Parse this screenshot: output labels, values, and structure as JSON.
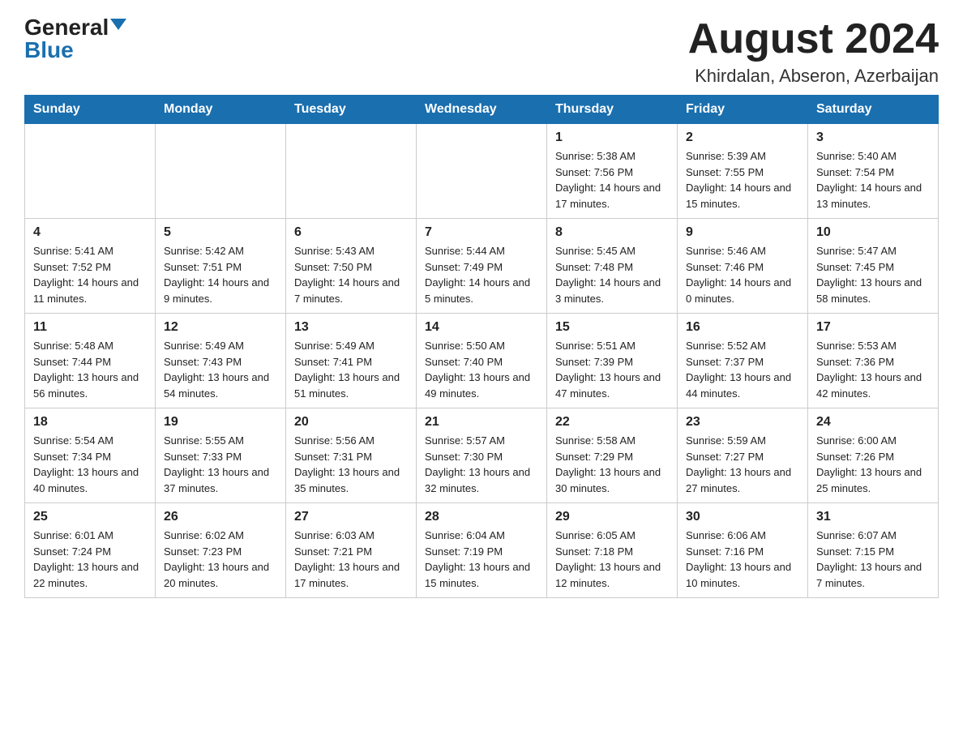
{
  "header": {
    "logo_general": "General",
    "logo_blue": "Blue",
    "month_year": "August 2024",
    "location": "Khirdalan, Abseron, Azerbaijan"
  },
  "days_of_week": [
    "Sunday",
    "Monday",
    "Tuesday",
    "Wednesday",
    "Thursday",
    "Friday",
    "Saturday"
  ],
  "weeks": [
    [
      {
        "day": "",
        "info": ""
      },
      {
        "day": "",
        "info": ""
      },
      {
        "day": "",
        "info": ""
      },
      {
        "day": "",
        "info": ""
      },
      {
        "day": "1",
        "info": "Sunrise: 5:38 AM\nSunset: 7:56 PM\nDaylight: 14 hours and 17 minutes."
      },
      {
        "day": "2",
        "info": "Sunrise: 5:39 AM\nSunset: 7:55 PM\nDaylight: 14 hours and 15 minutes."
      },
      {
        "day": "3",
        "info": "Sunrise: 5:40 AM\nSunset: 7:54 PM\nDaylight: 14 hours and 13 minutes."
      }
    ],
    [
      {
        "day": "4",
        "info": "Sunrise: 5:41 AM\nSunset: 7:52 PM\nDaylight: 14 hours and 11 minutes."
      },
      {
        "day": "5",
        "info": "Sunrise: 5:42 AM\nSunset: 7:51 PM\nDaylight: 14 hours and 9 minutes."
      },
      {
        "day": "6",
        "info": "Sunrise: 5:43 AM\nSunset: 7:50 PM\nDaylight: 14 hours and 7 minutes."
      },
      {
        "day": "7",
        "info": "Sunrise: 5:44 AM\nSunset: 7:49 PM\nDaylight: 14 hours and 5 minutes."
      },
      {
        "day": "8",
        "info": "Sunrise: 5:45 AM\nSunset: 7:48 PM\nDaylight: 14 hours and 3 minutes."
      },
      {
        "day": "9",
        "info": "Sunrise: 5:46 AM\nSunset: 7:46 PM\nDaylight: 14 hours and 0 minutes."
      },
      {
        "day": "10",
        "info": "Sunrise: 5:47 AM\nSunset: 7:45 PM\nDaylight: 13 hours and 58 minutes."
      }
    ],
    [
      {
        "day": "11",
        "info": "Sunrise: 5:48 AM\nSunset: 7:44 PM\nDaylight: 13 hours and 56 minutes."
      },
      {
        "day": "12",
        "info": "Sunrise: 5:49 AM\nSunset: 7:43 PM\nDaylight: 13 hours and 54 minutes."
      },
      {
        "day": "13",
        "info": "Sunrise: 5:49 AM\nSunset: 7:41 PM\nDaylight: 13 hours and 51 minutes."
      },
      {
        "day": "14",
        "info": "Sunrise: 5:50 AM\nSunset: 7:40 PM\nDaylight: 13 hours and 49 minutes."
      },
      {
        "day": "15",
        "info": "Sunrise: 5:51 AM\nSunset: 7:39 PM\nDaylight: 13 hours and 47 minutes."
      },
      {
        "day": "16",
        "info": "Sunrise: 5:52 AM\nSunset: 7:37 PM\nDaylight: 13 hours and 44 minutes."
      },
      {
        "day": "17",
        "info": "Sunrise: 5:53 AM\nSunset: 7:36 PM\nDaylight: 13 hours and 42 minutes."
      }
    ],
    [
      {
        "day": "18",
        "info": "Sunrise: 5:54 AM\nSunset: 7:34 PM\nDaylight: 13 hours and 40 minutes."
      },
      {
        "day": "19",
        "info": "Sunrise: 5:55 AM\nSunset: 7:33 PM\nDaylight: 13 hours and 37 minutes."
      },
      {
        "day": "20",
        "info": "Sunrise: 5:56 AM\nSunset: 7:31 PM\nDaylight: 13 hours and 35 minutes."
      },
      {
        "day": "21",
        "info": "Sunrise: 5:57 AM\nSunset: 7:30 PM\nDaylight: 13 hours and 32 minutes."
      },
      {
        "day": "22",
        "info": "Sunrise: 5:58 AM\nSunset: 7:29 PM\nDaylight: 13 hours and 30 minutes."
      },
      {
        "day": "23",
        "info": "Sunrise: 5:59 AM\nSunset: 7:27 PM\nDaylight: 13 hours and 27 minutes."
      },
      {
        "day": "24",
        "info": "Sunrise: 6:00 AM\nSunset: 7:26 PM\nDaylight: 13 hours and 25 minutes."
      }
    ],
    [
      {
        "day": "25",
        "info": "Sunrise: 6:01 AM\nSunset: 7:24 PM\nDaylight: 13 hours and 22 minutes."
      },
      {
        "day": "26",
        "info": "Sunrise: 6:02 AM\nSunset: 7:23 PM\nDaylight: 13 hours and 20 minutes."
      },
      {
        "day": "27",
        "info": "Sunrise: 6:03 AM\nSunset: 7:21 PM\nDaylight: 13 hours and 17 minutes."
      },
      {
        "day": "28",
        "info": "Sunrise: 6:04 AM\nSunset: 7:19 PM\nDaylight: 13 hours and 15 minutes."
      },
      {
        "day": "29",
        "info": "Sunrise: 6:05 AM\nSunset: 7:18 PM\nDaylight: 13 hours and 12 minutes."
      },
      {
        "day": "30",
        "info": "Sunrise: 6:06 AM\nSunset: 7:16 PM\nDaylight: 13 hours and 10 minutes."
      },
      {
        "day": "31",
        "info": "Sunrise: 6:07 AM\nSunset: 7:15 PM\nDaylight: 13 hours and 7 minutes."
      }
    ]
  ]
}
